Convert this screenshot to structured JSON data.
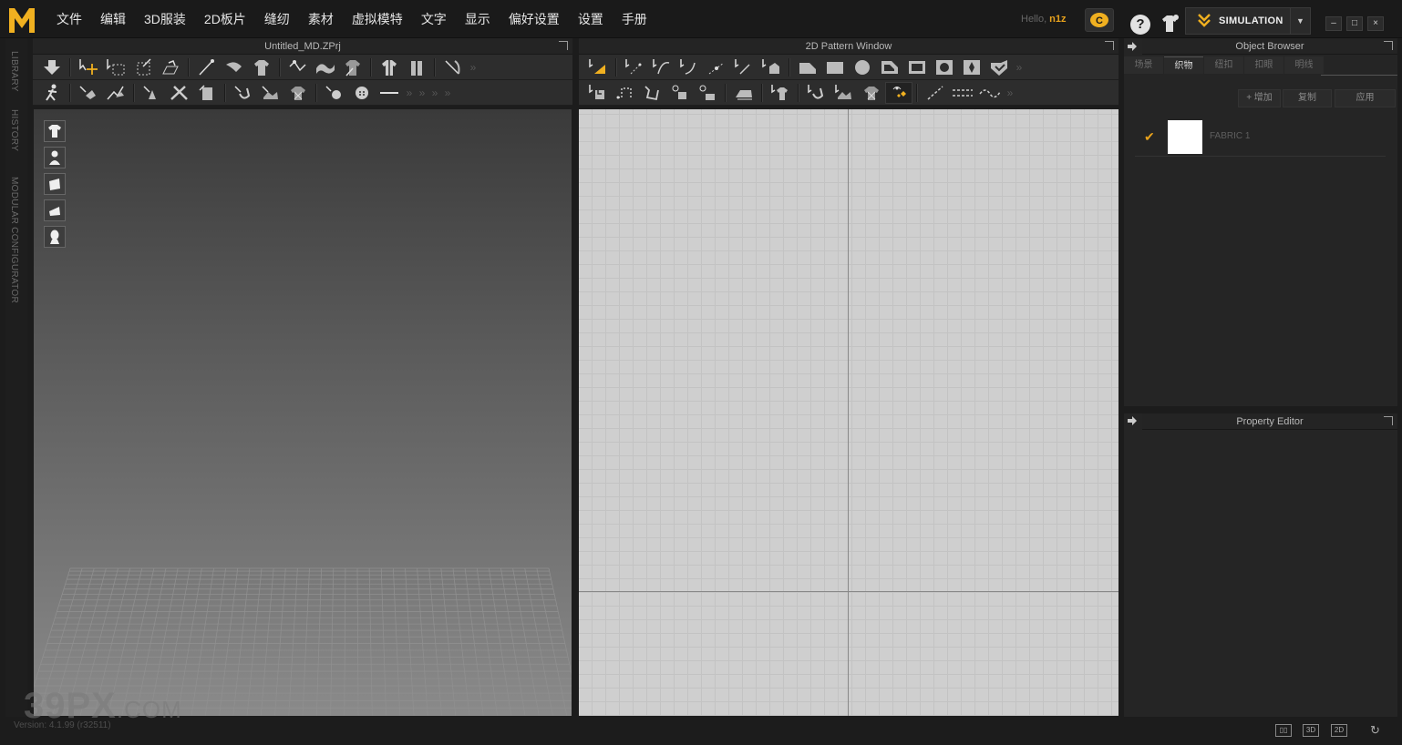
{
  "app": {
    "accent": "#e8a21c"
  },
  "menu": [
    "文件",
    "编辑",
    "3D服装",
    "2D板片",
    "缝纫",
    "素材",
    "虚拟模特",
    "文字",
    "显示",
    "偏好设置",
    "设置",
    "手册"
  ],
  "user": {
    "hello": "Hello,",
    "name": "n1z"
  },
  "simulation": {
    "label": "SIMULATION"
  },
  "window_controls": {
    "minimize": "–",
    "maximize": "□",
    "close": "×"
  },
  "left_strip": {
    "tabs": [
      "LIBRARY",
      "HISTORY",
      "MODULAR CONFIGURATOR"
    ]
  },
  "panel3d": {
    "title": "Untitled_MD.ZPrj"
  },
  "panel2d": {
    "title": "2D Pattern Window"
  },
  "object_browser": {
    "title": "Object Browser",
    "tabs": [
      "场景",
      "织物",
      "纽扣",
      "扣眼",
      "明线"
    ],
    "active_tab": "织物",
    "buttons": {
      "add": "+ 增加",
      "copy": "复制",
      "apply": "应用"
    },
    "fabrics": [
      {
        "name": "FABRIC 1",
        "color": "#ffffff",
        "checked": true
      }
    ]
  },
  "property_editor": {
    "title": "Property Editor"
  },
  "status": {
    "version": "Version: 4.1.99 (r32511)",
    "views": [
      "3D",
      "2D"
    ]
  },
  "watermark": {
    "main": "39PX",
    "sub": ".COM"
  }
}
